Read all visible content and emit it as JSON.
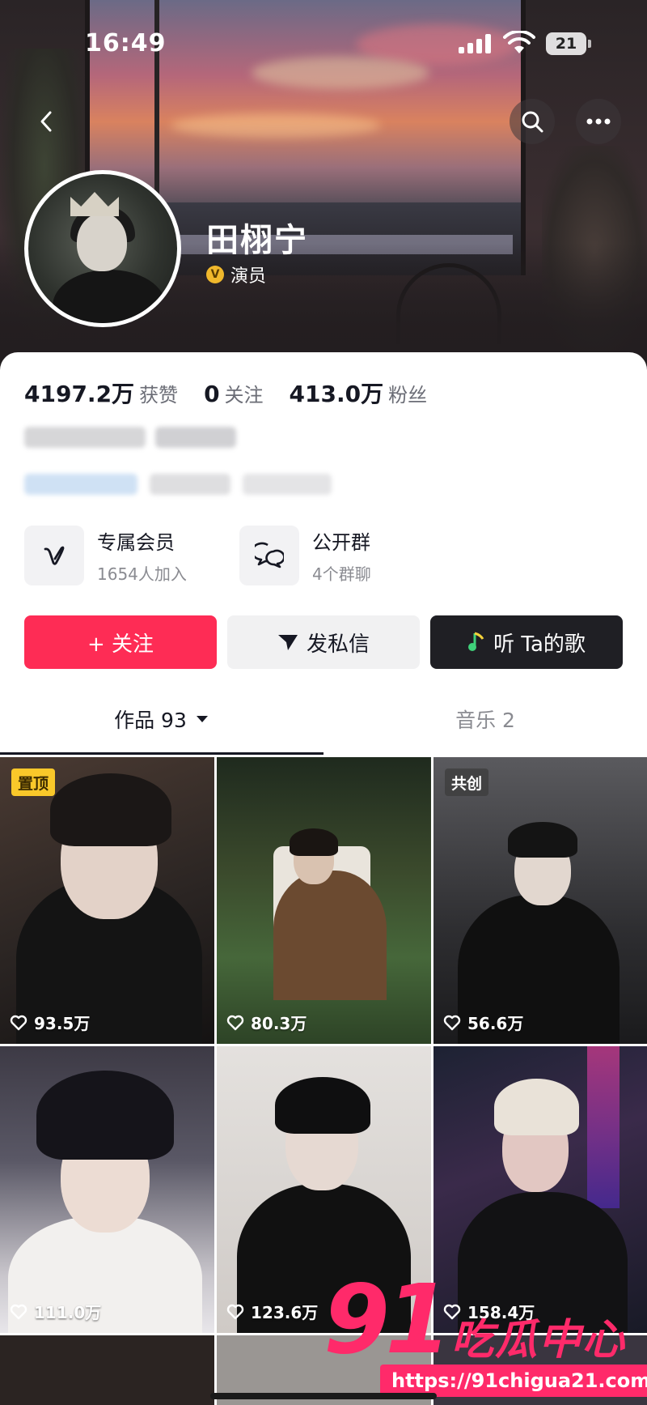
{
  "status_bar": {
    "time": "16:49",
    "battery": "21"
  },
  "profile": {
    "name": "田栩宁",
    "verify_label": "演员",
    "verify_badge": "V"
  },
  "stats": [
    {
      "value": "4197.2万",
      "label": "获赞"
    },
    {
      "value": "0",
      "label": "关注"
    },
    {
      "value": "413.0万",
      "label": "粉丝"
    }
  ],
  "features": {
    "membership": {
      "title": "专属会员",
      "sub": "1654人加入"
    },
    "group": {
      "title": "公开群",
      "sub": "4个群聊"
    }
  },
  "actions": {
    "follow": "+ 关注",
    "dm": "发私信",
    "song": "听 Ta的歌"
  },
  "tabs": {
    "works": "作品 93",
    "music": "音乐 2"
  },
  "videos": [
    {
      "likes": "93.5万",
      "tag": "置顶"
    },
    {
      "likes": "80.3万",
      "tag": ""
    },
    {
      "likes": "56.6万",
      "tag": "共创"
    },
    {
      "likes": "111.0万",
      "tag": ""
    },
    {
      "likes": "123.6万",
      "tag": ""
    },
    {
      "likes": "158.4万",
      "tag": ""
    }
  ],
  "watermark": {
    "number": "91",
    "text": "吃瓜中心",
    "url": "https://91chigua21.com"
  },
  "colors": {
    "accent": "#fe2c55",
    "pin_tag": "#f9c82a",
    "watermark": "#ff2a6a"
  }
}
